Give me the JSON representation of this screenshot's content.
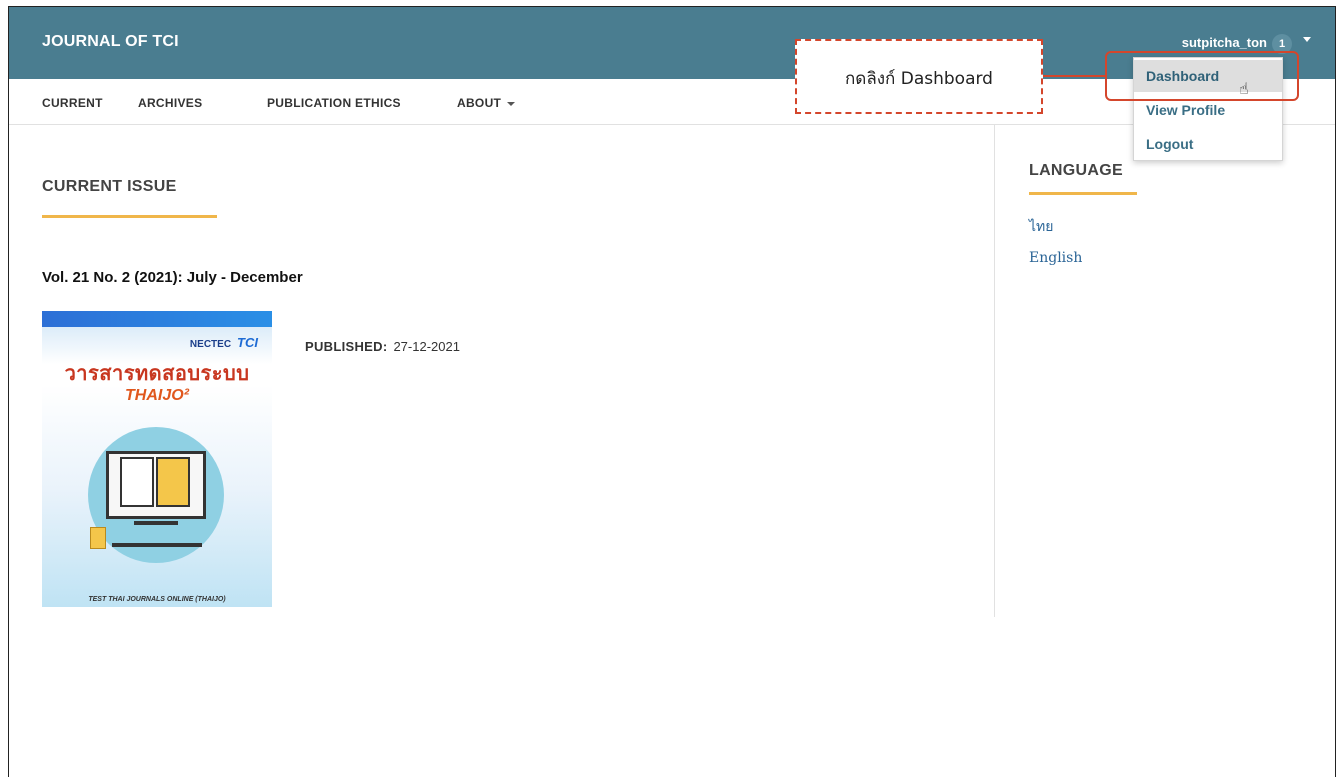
{
  "header": {
    "site_title": "JOURNAL OF TCI",
    "username": "sutpitcha_ton",
    "notification_count": "1"
  },
  "nav": {
    "items": [
      "CURRENT",
      "ARCHIVES",
      "PUBLICATION ETHICS",
      "ABOUT"
    ]
  },
  "user_menu": {
    "items": [
      "Dashboard",
      "View Profile",
      "Logout"
    ],
    "highlighted": "Dashboard"
  },
  "callout": {
    "text": "กดลิงก์ Dashboard",
    "color": "#d4462c"
  },
  "main": {
    "section_title": "CURRENT ISSUE",
    "issue_title": "Vol. 21 No. 2 (2021): July - December",
    "published_label": "PUBLISHED:",
    "published_date": "27-12-2021"
  },
  "cover": {
    "logo_left": "NECTEC",
    "logo_right": "TCI",
    "thai_title": "วารสารทดสอบระบบ",
    "brand": "THAIJO²",
    "footer": "TEST THAI JOURNALS ONLINE (THAIJO)"
  },
  "sidebar": {
    "language_title": "LANGUAGE",
    "languages": [
      "ไทย",
      "English"
    ]
  },
  "colors": {
    "header_bg": "#4a7d90",
    "accent_underline": "#f0b64a",
    "link": "#2a6496"
  }
}
